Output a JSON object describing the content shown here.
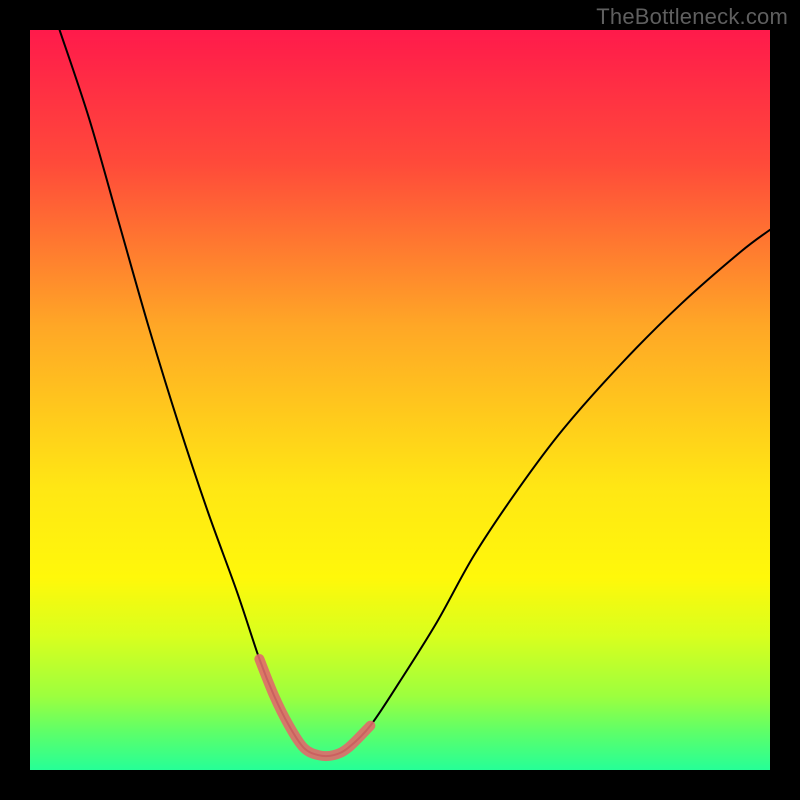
{
  "watermark": "TheBottleneck.com",
  "chart_data": {
    "type": "line",
    "title": "",
    "xlabel": "",
    "ylabel": "",
    "xlim": [
      0,
      100
    ],
    "ylim": [
      0,
      100
    ],
    "grid": false,
    "legend": false,
    "gradient_stops": [
      {
        "offset": 0.0,
        "color": "#ff1a4b"
      },
      {
        "offset": 0.18,
        "color": "#ff4a3a"
      },
      {
        "offset": 0.4,
        "color": "#ffa726"
      },
      {
        "offset": 0.62,
        "color": "#ffe714"
      },
      {
        "offset": 0.74,
        "color": "#fff80a"
      },
      {
        "offset": 0.82,
        "color": "#d8ff1e"
      },
      {
        "offset": 0.9,
        "color": "#9dff3e"
      },
      {
        "offset": 0.95,
        "color": "#5cff6a"
      },
      {
        "offset": 1.0,
        "color": "#26ff97"
      }
    ],
    "series": [
      {
        "name": "bottleneck-curve",
        "stroke": "#000000",
        "stroke_width": 2,
        "x": [
          4,
          8,
          12,
          16,
          20,
          24,
          28,
          31,
          33,
          35,
          37,
          39,
          41,
          43,
          46,
          50,
          55,
          60,
          66,
          72,
          80,
          88,
          96,
          100
        ],
        "y": [
          100,
          88,
          74,
          60,
          47,
          35,
          24,
          15,
          10,
          6,
          3,
          2,
          2,
          3,
          6,
          12,
          20,
          29,
          38,
          46,
          55,
          63,
          70,
          73
        ]
      },
      {
        "name": "highlight-band",
        "stroke": "#e06a6a",
        "stroke_width": 10,
        "linecap": "round",
        "x": [
          31,
          33,
          35,
          37,
          39,
          41,
          43,
          46
        ],
        "y": [
          15,
          10,
          6,
          3,
          2,
          2,
          3,
          6
        ]
      }
    ]
  }
}
